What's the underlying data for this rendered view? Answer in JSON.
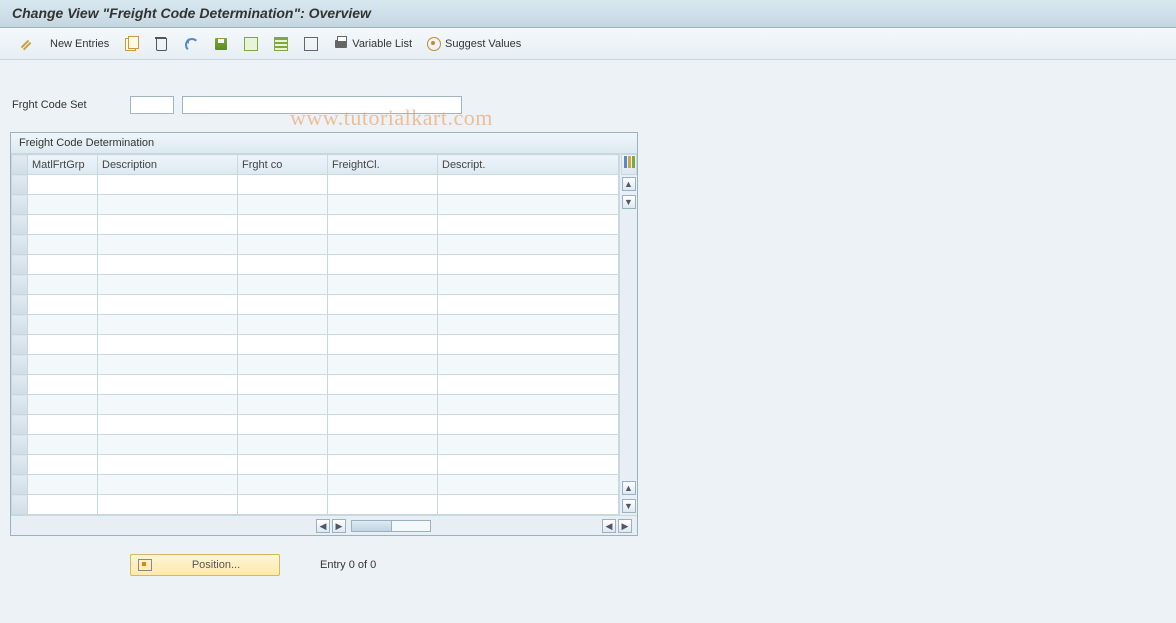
{
  "title": "Change View \"Freight Code Determination\": Overview",
  "toolbar": {
    "new_entries": "New Entries",
    "variable_list": "Variable List",
    "suggest_values": "Suggest Values"
  },
  "form": {
    "frght_code_set_label": "Frght Code Set",
    "code_value": "",
    "desc_value": ""
  },
  "table": {
    "caption": "Freight Code Determination",
    "columns": {
      "matl_frt_grp": "MatlFrtGrp",
      "description": "Description",
      "frght_co": "Frght co",
      "freight_cl": "FreightCl.",
      "descript": "Descript."
    },
    "row_count": 17
  },
  "footer": {
    "position_label": "Position...",
    "entry_text": "Entry 0 of 0"
  },
  "watermark": "www.tutorialkart.com"
}
